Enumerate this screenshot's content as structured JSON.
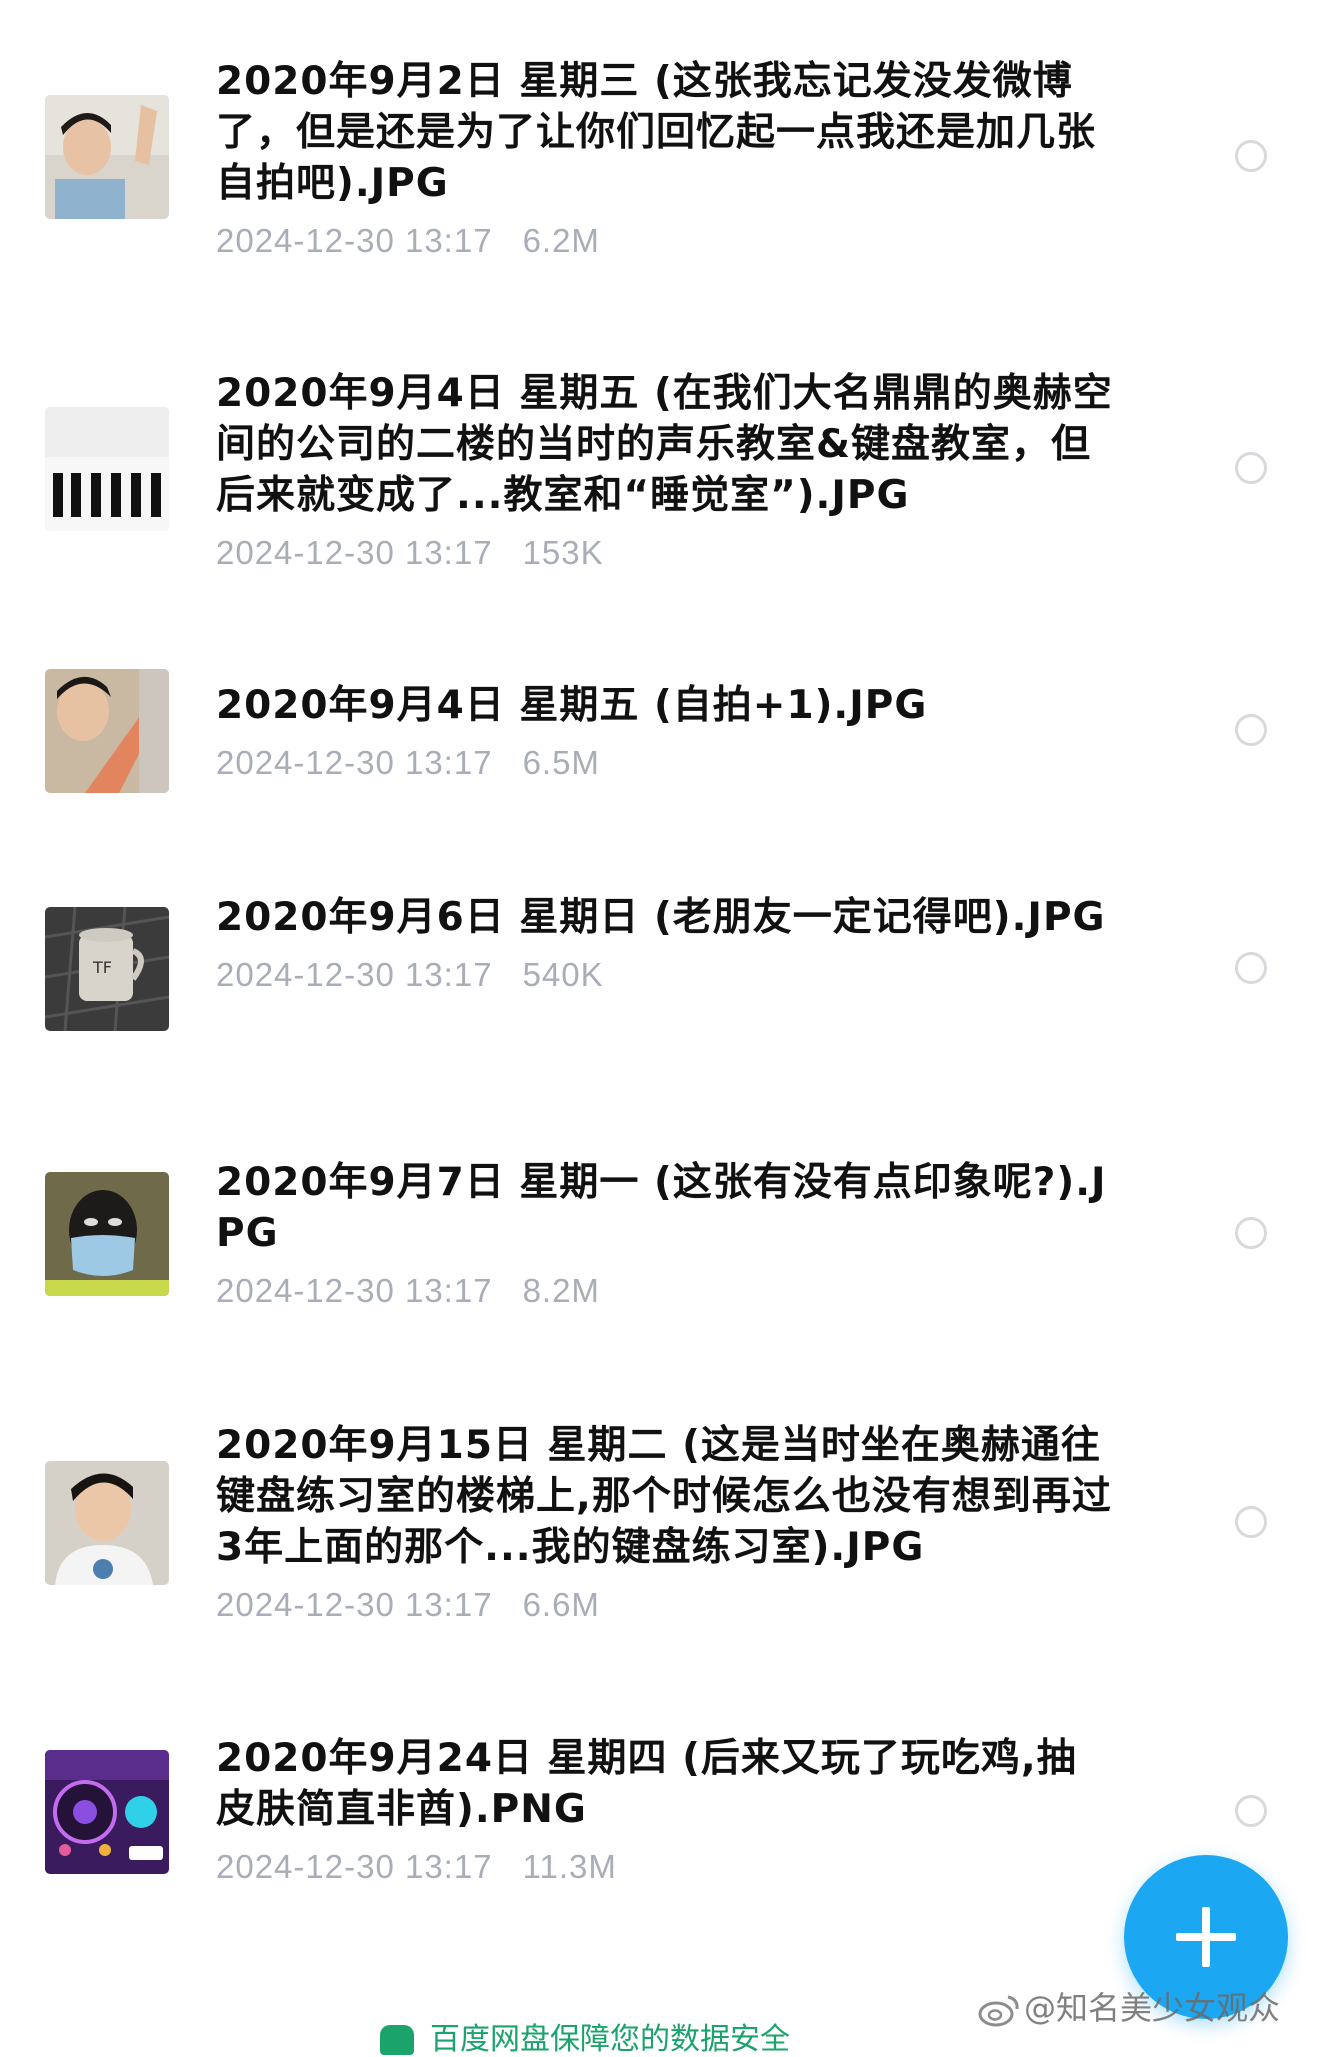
{
  "files": [
    {
      "name": "2020年9月2日 星期三 (这张我忘记发没发微博了，但是还是为了让你们回忆起一点我还是加几张自拍吧).JPG",
      "date": "2024-12-30 13:17",
      "size": "6.2M",
      "thumbnail": "selfie-photo"
    },
    {
      "name": "2020年9月4日 星期五 (在我们大名鼎鼎的奥赫空间的公司的二楼的当时的声乐教室&键盘教室，但后来就变成了...教室和“睡觉室”).JPG",
      "date": "2024-12-30 13:17",
      "size": "153K",
      "thumbnail": "piano-keyboard-photo"
    },
    {
      "name": "2020年9月4日 星期五 (自拍+1).JPG",
      "date": "2024-12-30 13:17",
      "size": "6.5M",
      "thumbnail": "selfie-photo"
    },
    {
      "name": "2020年9月6日 星期日 (老朋友一定记得吧).JPG",
      "date": "2024-12-30 13:17",
      "size": "540K",
      "thumbnail": "mug-photo"
    },
    {
      "name": "2020年9月7日 星期一 (这张有没有点印象呢?).JPG",
      "date": "2024-12-30 13:17",
      "size": "8.2M",
      "thumbnail": "masked-selfie-photo"
    },
    {
      "name": "2020年9月15日 星期二 (这是当时坐在奥赫通往键盘练习室的楼梯上,那个时候怎么也没有想到再过3年上面的那个...我的键盘练习室).JPG",
      "date": "2024-12-30 13:17",
      "size": "6.6M",
      "thumbnail": "selfie-photo"
    },
    {
      "name": "2020年9月24日 星期四 (后来又玩了玩吃鸡,抽皮肤简直非酋).PNG",
      "date": "2024-12-30 13:17",
      "size": "11.3M",
      "thumbnail": "game-screenshot"
    }
  ],
  "fab": {
    "icon": "plus-icon",
    "color": "#1ba7f2"
  },
  "watermark": {
    "text": "@知名美少女观众",
    "icon": "weibo-icon"
  },
  "bottom_bar": {
    "text": "百度网盘保障您的数据安全",
    "icon": "shield-icon",
    "color": "#1aa36b"
  },
  "colors": {
    "title": "#111111",
    "meta": "#a9adb7",
    "radio": "#d7d9dd"
  }
}
